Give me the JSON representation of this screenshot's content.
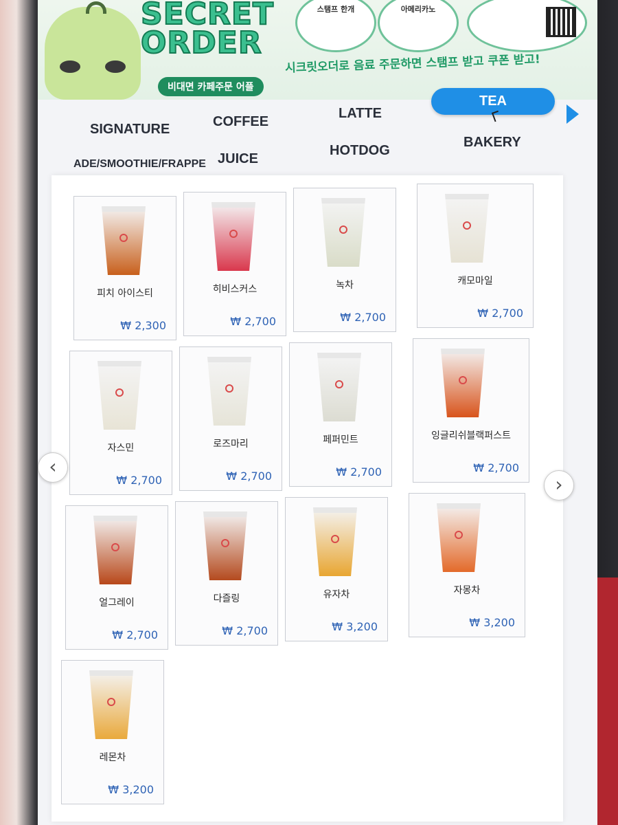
{
  "banner": {
    "title_line1": "SECRET",
    "title_line2": "ORDER",
    "subtitle": "비대면 카페주문 어플",
    "promo": "시크릿오더로 음료 주문하면 스탬프 받고 쿠폰 받고!",
    "bubble1_text": "스탬프 한개",
    "bubble2_text": "아메리카노"
  },
  "tabs": [
    {
      "label": "SIGNATURE"
    },
    {
      "label": "COFFEE"
    },
    {
      "label": "LATTE"
    },
    {
      "label": "TEA",
      "active": true
    },
    {
      "label": "ADE/SMOOTHIE/FRAPPE"
    },
    {
      "label": "JUICE"
    },
    {
      "label": "HOTDOG"
    },
    {
      "label": "BAKERY"
    }
  ],
  "menu": [
    {
      "name": "피치 아이스티",
      "price": "₩ 2,300",
      "color": "#c8601c"
    },
    {
      "name": "히비스커스",
      "price": "₩ 2,700",
      "color": "#d9384d"
    },
    {
      "name": "녹차",
      "price": "₩ 2,700",
      "color": "#d9dcc8"
    },
    {
      "name": "캐모마일",
      "price": "₩ 2,700",
      "color": "#e6e2d4"
    },
    {
      "name": "자스민",
      "price": "₩ 2,700",
      "color": "#e8e4d6"
    },
    {
      "name": "로즈마리",
      "price": "₩ 2,700",
      "color": "#e6e4d8"
    },
    {
      "name": "페퍼민트",
      "price": "₩ 2,700",
      "color": "#dcdcd2"
    },
    {
      "name": "잉글리쉬블랙퍼스트",
      "price": "₩ 2,700",
      "color": "#d8541c"
    },
    {
      "name": "얼그레이",
      "price": "₩ 2,700",
      "color": "#b8481a"
    },
    {
      "name": "다즐링",
      "price": "₩ 2,700",
      "color": "#b44a1e"
    },
    {
      "name": "유자차",
      "price": "₩ 3,200",
      "color": "#e8a632"
    },
    {
      "name": "자몽차",
      "price": "₩ 3,200",
      "color": "#e36a2a"
    },
    {
      "name": "레몬차",
      "price": "₩ 3,200",
      "color": "#e9a93c"
    }
  ],
  "nav": {
    "prev_icon": "‹",
    "next_icon": "›"
  }
}
